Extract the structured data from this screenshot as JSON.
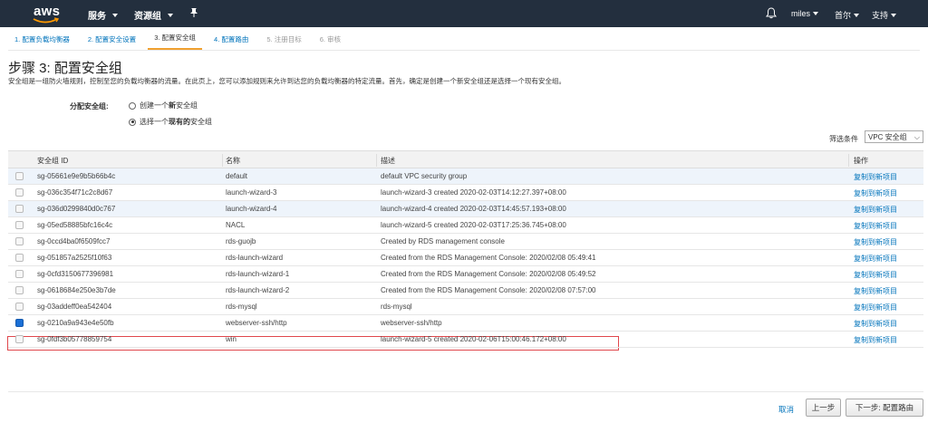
{
  "nav": {
    "logo": "aws",
    "services": "服务",
    "resource_groups": "资源组",
    "user": "miles",
    "region": "首尔",
    "support": "支持"
  },
  "steps": [
    {
      "label": "1. 配置负载均衡器",
      "state": "link"
    },
    {
      "label": "2. 配置安全设置",
      "state": "link"
    },
    {
      "label": "3. 配置安全组",
      "state": "active"
    },
    {
      "label": "4. 配置路由",
      "state": "link"
    },
    {
      "label": "5. 注册目标",
      "state": "disabled"
    },
    {
      "label": "6. 审核",
      "state": "disabled"
    }
  ],
  "page": {
    "title": "步骤 3: 配置安全组",
    "description": "安全组是一组防火墙规则，控制至您的负载均衡器的流量。在此页上，您可以添加规则来允许到达您的负载均衡器的特定流量。首先，确定是创建一个新安全组还是选择一个现有安全组。"
  },
  "assign": {
    "label": "分配安全组:",
    "option_new_prefix": "创建一个",
    "option_new_bold": "新",
    "option_new_suffix": "安全组",
    "option_existing_prefix": "选择一个",
    "option_existing_bold": "现有的",
    "option_existing_suffix": "安全组",
    "selected": "existing"
  },
  "filter": {
    "label": "筛选条件",
    "value": "VPC 安全组"
  },
  "table": {
    "columns": [
      "安全组 ID",
      "名称",
      "描述",
      "操作"
    ],
    "action_label": "复制到新项目",
    "rows": [
      {
        "id": "sg-05661e9e9b5b66b4c",
        "name": "default",
        "desc": "default VPC security group",
        "checked": false
      },
      {
        "id": "sg-036c354f71c2c8d67",
        "name": "launch-wizard-3",
        "desc": "launch-wizard-3 created 2020-02-03T14:12:27.397+08:00",
        "checked": false
      },
      {
        "id": "sg-036d0299840d0c767",
        "name": "launch-wizard-4",
        "desc": "launch-wizard-4 created 2020-02-03T14:45:57.193+08:00",
        "checked": false
      },
      {
        "id": "sg-05ed58885bfc16c4c",
        "name": "NACL",
        "desc": "launch-wizard-5 created 2020-02-03T17:25:36.745+08:00",
        "checked": false
      },
      {
        "id": "sg-0ccd4ba0f6509fcc7",
        "name": "rds-guojb",
        "desc": "Created by RDS management console",
        "checked": false
      },
      {
        "id": "sg-051857a2525f10f63",
        "name": "rds-launch-wizard",
        "desc": "Created from the RDS Management Console: 2020/02/08 05:49:41",
        "checked": false
      },
      {
        "id": "sg-0cfd3150677396981",
        "name": "rds-launch-wizard-1",
        "desc": "Created from the RDS Management Console: 2020/02/08 05:49:52",
        "checked": false
      },
      {
        "id": "sg-0618684e250e3b7de",
        "name": "rds-launch-wizard-2",
        "desc": "Created from the RDS Management Console: 2020/02/08 07:57:00",
        "checked": false
      },
      {
        "id": "sg-03addeff0ea542404",
        "name": "rds-mysql",
        "desc": "rds-mysql",
        "checked": false
      },
      {
        "id": "sg-0210a9a943e4e50fb",
        "name": "webserver-ssh/http",
        "desc": "webserver-ssh/http",
        "checked": true
      },
      {
        "id": "sg-0fdf3b05778859754",
        "name": "win",
        "desc": "launch-wizard-5 created 2020-02-06T15:00:46.172+08:00",
        "checked": false
      }
    ]
  },
  "footer": {
    "cancel": "取消",
    "previous": "上一步",
    "next": "下一步: 配置路由"
  },
  "colors": {
    "nav_bg": "#232f3e",
    "link": "#0073bb",
    "highlight": "#e0474c",
    "row_alt": "#eef4fb"
  }
}
